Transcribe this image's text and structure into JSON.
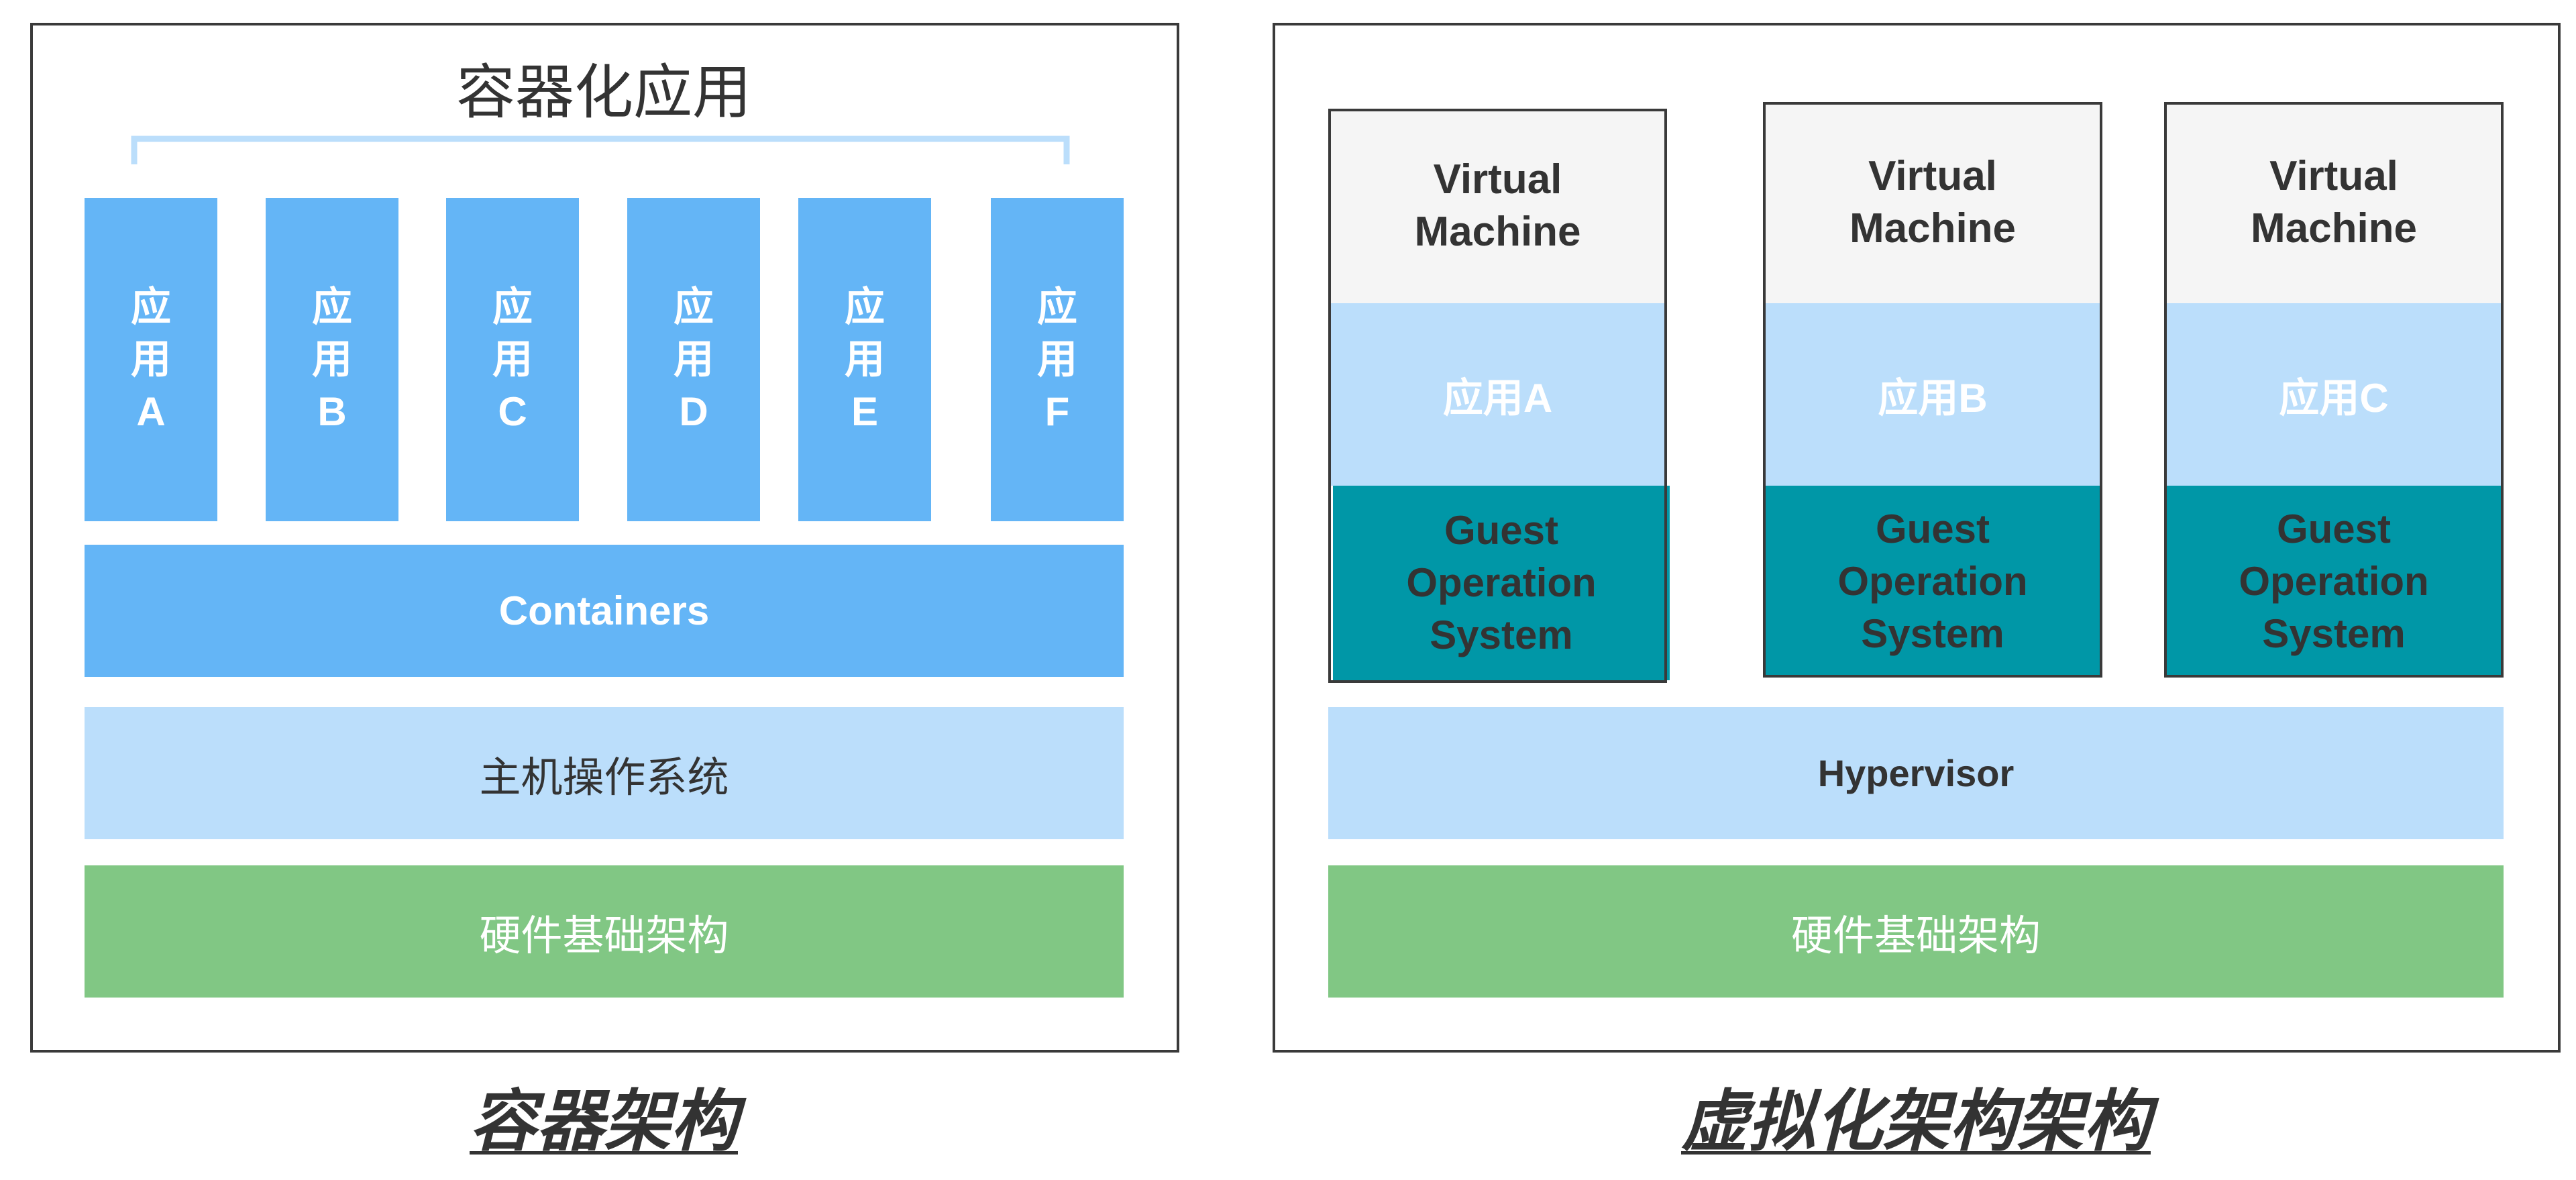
{
  "container_diagram": {
    "heading": "容器化应用",
    "apps": [
      {
        "label": "应\n用\nA"
      },
      {
        "label": "应\n用\nB"
      },
      {
        "label": "应\n用\nC"
      },
      {
        "label": "应\n用\nD"
      },
      {
        "label": "应\n用\nE"
      },
      {
        "label": "应\n用\nF"
      }
    ],
    "containers_label": "Containers",
    "host_os_label": "主机操作系统",
    "hardware_label": "硬件基础架构",
    "caption": "容器架构"
  },
  "vm_diagram": {
    "vms": [
      {
        "title": "Virtual\nMachine",
        "app": "应用A",
        "guest_os": "Guest\nOperation\nSystem"
      },
      {
        "title": "Virtual\nMachine",
        "app": "应用B",
        "guest_os": "Guest\nOperation\nSystem"
      },
      {
        "title": "Virtual\nMachine",
        "app": "应用C",
        "guest_os": "Guest\nOperation\nSystem"
      }
    ],
    "hypervisor_label": "Hypervisor",
    "hardware_label": "硬件基础架构",
    "caption": "虚拟化架构架构"
  },
  "colors": {
    "app_blue": "#64b5f6",
    "light_blue": "#bbdefb",
    "hardware_green": "#81c784",
    "guest_teal": "#0097a7",
    "vm_header_grey": "#f5f5f5",
    "border": "#3a3a3a",
    "bracket": "#bbdefb"
  }
}
